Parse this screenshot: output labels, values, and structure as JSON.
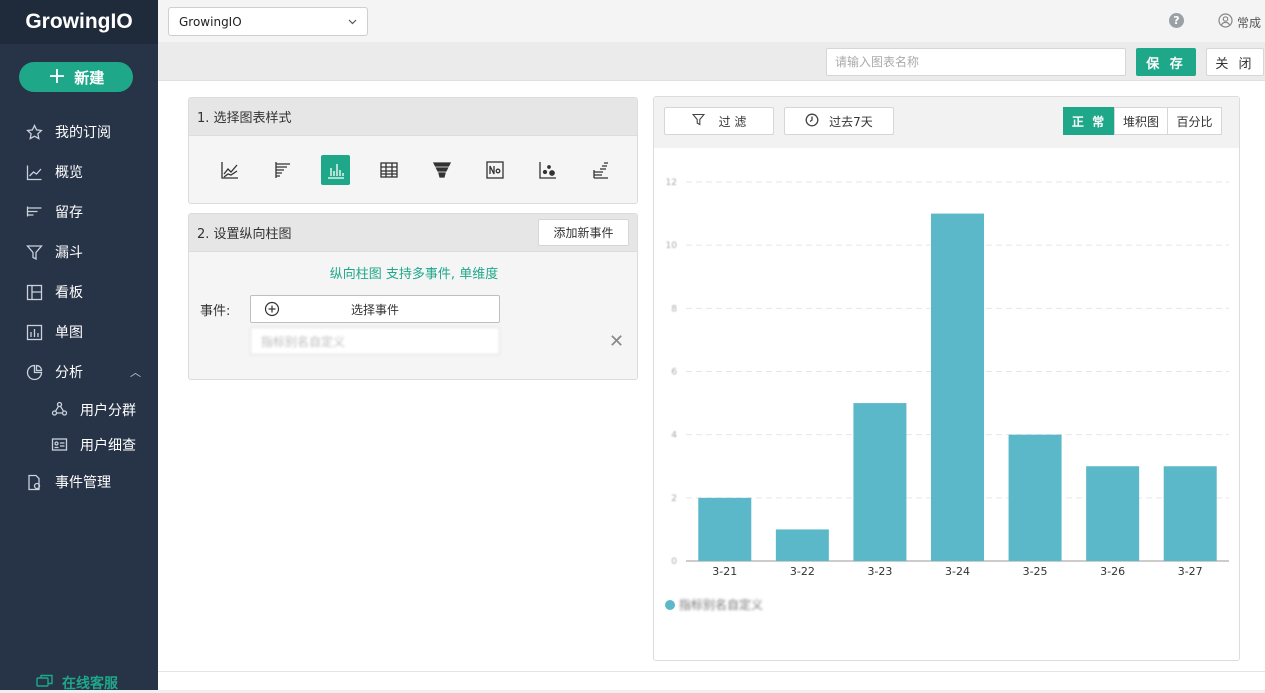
{
  "app": {
    "logo_text": "GrowingIO"
  },
  "sidebar": {
    "new_label": "新建",
    "items": [
      {
        "label": "我的订阅",
        "icon": "star-icon"
      },
      {
        "label": "概览",
        "icon": "line-chart-icon"
      },
      {
        "label": "留存",
        "icon": "retention-icon"
      },
      {
        "label": "漏斗",
        "icon": "funnel-icon"
      },
      {
        "label": "看板",
        "icon": "dashboard-icon"
      },
      {
        "label": "单图",
        "icon": "bar-chart-icon"
      },
      {
        "label": "分析",
        "icon": "pie-chart-icon"
      },
      {
        "label": "用户分群",
        "icon": "user-group-icon"
      },
      {
        "label": "用户细查",
        "icon": "user-card-icon"
      },
      {
        "label": "事件管理",
        "icon": "event-doc-icon"
      }
    ],
    "online_label": "在线客服"
  },
  "topbar": {
    "project": "GrowingIO",
    "user": "常成"
  },
  "toolbar": {
    "name_placeholder": "请输入图表名称",
    "save_label": "保 存",
    "close_label": "关 闭"
  },
  "panel1": {
    "title": "1. 选择图表样式"
  },
  "panel2": {
    "title": "2. 设置纵向柱图",
    "add_event": "添加新事件",
    "description": "纵向柱图 支持多事件, 单维度",
    "event_label": "事件:",
    "select_event": "选择事件",
    "alias_placeholder": "指标别名自定义"
  },
  "chart_panel": {
    "filter_label": "过 滤",
    "range_label": "过去7天",
    "modes": [
      "正 常",
      "堆积图",
      "百分比"
    ],
    "legend": "指标别名自定义"
  },
  "colors": {
    "accent": "#1fa78a",
    "sidebar": "#273346",
    "bar": "#5bb8c9"
  },
  "chart_data": {
    "type": "bar",
    "categories": [
      "3-21",
      "3-22",
      "3-23",
      "3-24",
      "3-25",
      "3-26",
      "3-27"
    ],
    "values": [
      2,
      1,
      5,
      11,
      4,
      3,
      3
    ],
    "ylim": [
      0,
      12
    ],
    "yticks": [
      0,
      2,
      4,
      6,
      8,
      10,
      12
    ],
    "grid": true,
    "legend_position": "bottom-left"
  }
}
